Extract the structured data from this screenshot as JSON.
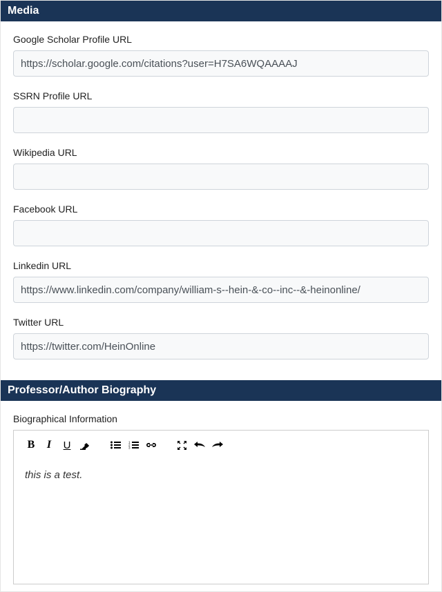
{
  "media": {
    "header": "Media",
    "fields": {
      "google_scholar": {
        "label": "Google Scholar Profile URL",
        "value": "https://scholar.google.com/citations?user=H7SA6WQAAAAJ"
      },
      "ssrn": {
        "label": "SSRN Profile URL",
        "value": ""
      },
      "wikipedia": {
        "label": "Wikipedia URL",
        "value": ""
      },
      "facebook": {
        "label": "Facebook URL",
        "value": ""
      },
      "linkedin": {
        "label": "Linkedin URL",
        "value": "https://www.linkedin.com/company/william-s--hein-&-co--inc--&-heinonline/"
      },
      "twitter": {
        "label": "Twitter URL",
        "value": "https://twitter.com/HeinOnline"
      }
    }
  },
  "biography": {
    "header": "Professor/Author Biography",
    "label": "Biographical Information",
    "content": "this is a test."
  }
}
